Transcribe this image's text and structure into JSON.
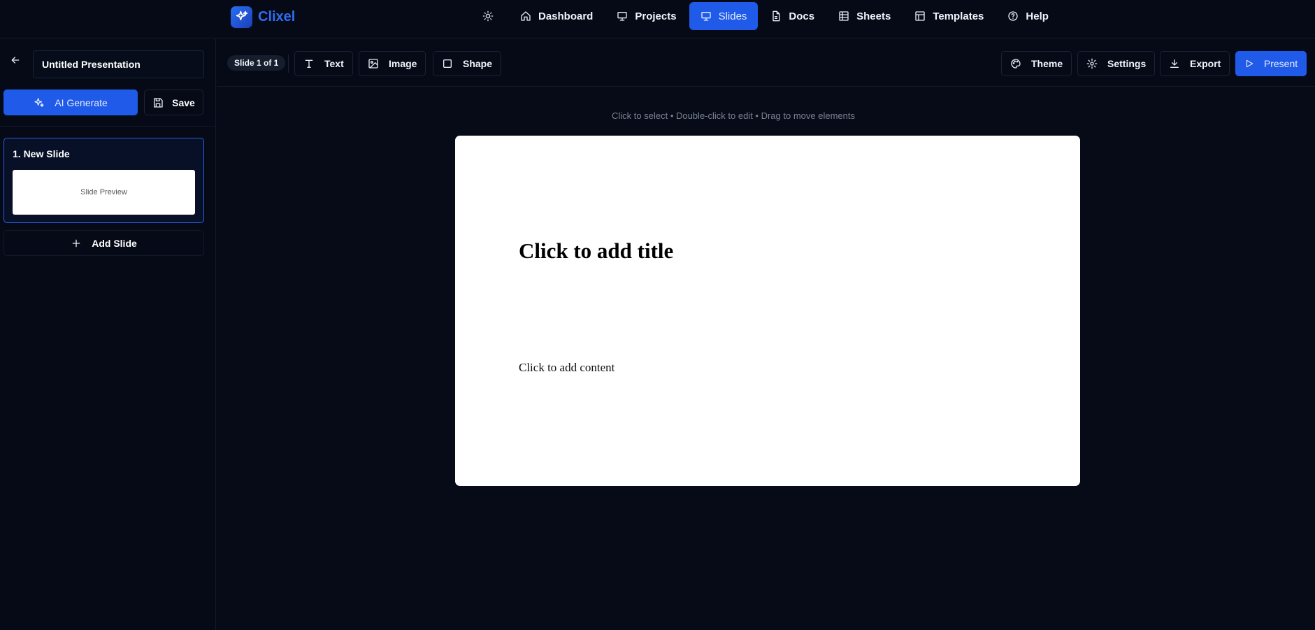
{
  "brand": {
    "name": "Clixel"
  },
  "nav": {
    "items": [
      {
        "label": "Dashboard",
        "icon": "home-icon"
      },
      {
        "label": "Projects",
        "icon": "presentation-icon"
      },
      {
        "label": "Slides",
        "icon": "presentation-icon",
        "active": true
      },
      {
        "label": "Docs",
        "icon": "document-icon"
      },
      {
        "label": "Sheets",
        "icon": "table-icon"
      },
      {
        "label": "Templates",
        "icon": "layout-icon"
      },
      {
        "label": "Help",
        "icon": "help-circle-icon"
      }
    ],
    "theme_toggle_icon": "sun-icon"
  },
  "sidebar": {
    "presentation_title": "Untitled Presentation",
    "ai_generate_label": "AI Generate",
    "save_label": "Save",
    "slides": [
      {
        "title": "1. New Slide",
        "preview_label": "Slide Preview"
      }
    ],
    "add_slide_label": "Add Slide"
  },
  "toolbar": {
    "slide_counter": "Slide 1 of 1",
    "text_label": "Text",
    "image_label": "Image",
    "shape_label": "Shape",
    "theme_label": "Theme",
    "settings_label": "Settings",
    "export_label": "Export",
    "present_label": "Present"
  },
  "canvas": {
    "hint": "Click to select • Double-click to edit • Drag to move elements",
    "title_placeholder": "Click to add title",
    "content_placeholder": "Click to add content"
  },
  "colors": {
    "accent": "#1f5ae8",
    "background": "#060b17",
    "brand": "#2e6cf3"
  }
}
